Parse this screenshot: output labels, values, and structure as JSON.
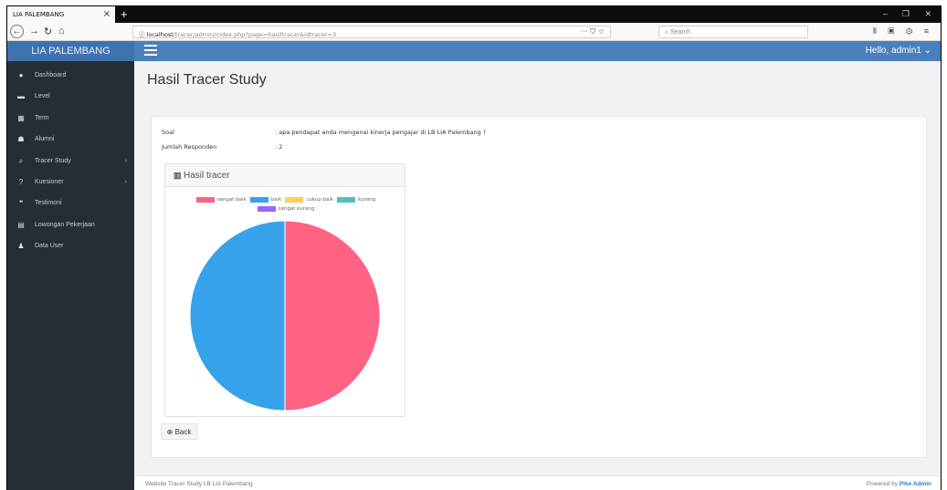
{
  "browser": {
    "tab_title": "LIA PALEMBANG",
    "tab_close": "×",
    "new_tab": "+",
    "url_host": "localhost",
    "url_path": "/tracer/admin/index.php?page=hasiltracer&idtracer=3",
    "url_icons": "··· ⛉ ☆",
    "search_placeholder": "Search"
  },
  "header": {
    "brand": "LIA PALEMBANG",
    "greeting": "Hello, admin1 ⌄"
  },
  "sidebar": {
    "items": [
      {
        "label": "Dashboard",
        "icon": "dashboard-icon",
        "glyph": "●",
        "chevron": ""
      },
      {
        "label": "Level",
        "icon": "level-icon",
        "glyph": "▬",
        "chevron": ""
      },
      {
        "label": "Term",
        "icon": "calendar-icon",
        "glyph": "▦",
        "chevron": ""
      },
      {
        "label": "Alumni",
        "icon": "users-icon",
        "glyph": "☗",
        "chevron": ""
      },
      {
        "label": "Tracer Study",
        "icon": "search-icon",
        "glyph": "⌕",
        "chevron": "›"
      },
      {
        "label": "Kuesioner",
        "icon": "question-icon",
        "glyph": "?",
        "chevron": "›"
      },
      {
        "label": "Testimoni",
        "icon": "quote-icon",
        "glyph": "❝",
        "chevron": ""
      },
      {
        "label": "Lowongan Pekerjaan",
        "icon": "newspaper-icon",
        "glyph": "▤",
        "chevron": ""
      },
      {
        "label": "Data User",
        "icon": "user-icon",
        "glyph": "♟",
        "chevron": ""
      }
    ]
  },
  "main": {
    "page_title": "Hasil Tracer Study",
    "soal_label": "Soal",
    "soal_value": ": apa pendapat anda mengenai kinerja pengajar di LB LIA Palembang ?",
    "responden_label": "Jumlah Responden",
    "responden_value": ": 2",
    "chart_card_title": "Hasil tracer",
    "back_label": "Back"
  },
  "chart_data": {
    "type": "pie",
    "categories": [
      "sangat baik",
      "baik",
      "cukup baik",
      "kurang",
      "sangat kurang"
    ],
    "values": [
      1,
      1,
      0,
      0,
      0
    ],
    "colors": [
      "#ff6384",
      "#36a2eb",
      "#ffce56",
      "#4bc0c0",
      "#9966ff"
    ],
    "legend_position": "top"
  },
  "footer": {
    "left": "Website Tracer Study LB LIA Palembang",
    "right_prefix": "Powered by ",
    "right_brand": "Pike Admin"
  }
}
